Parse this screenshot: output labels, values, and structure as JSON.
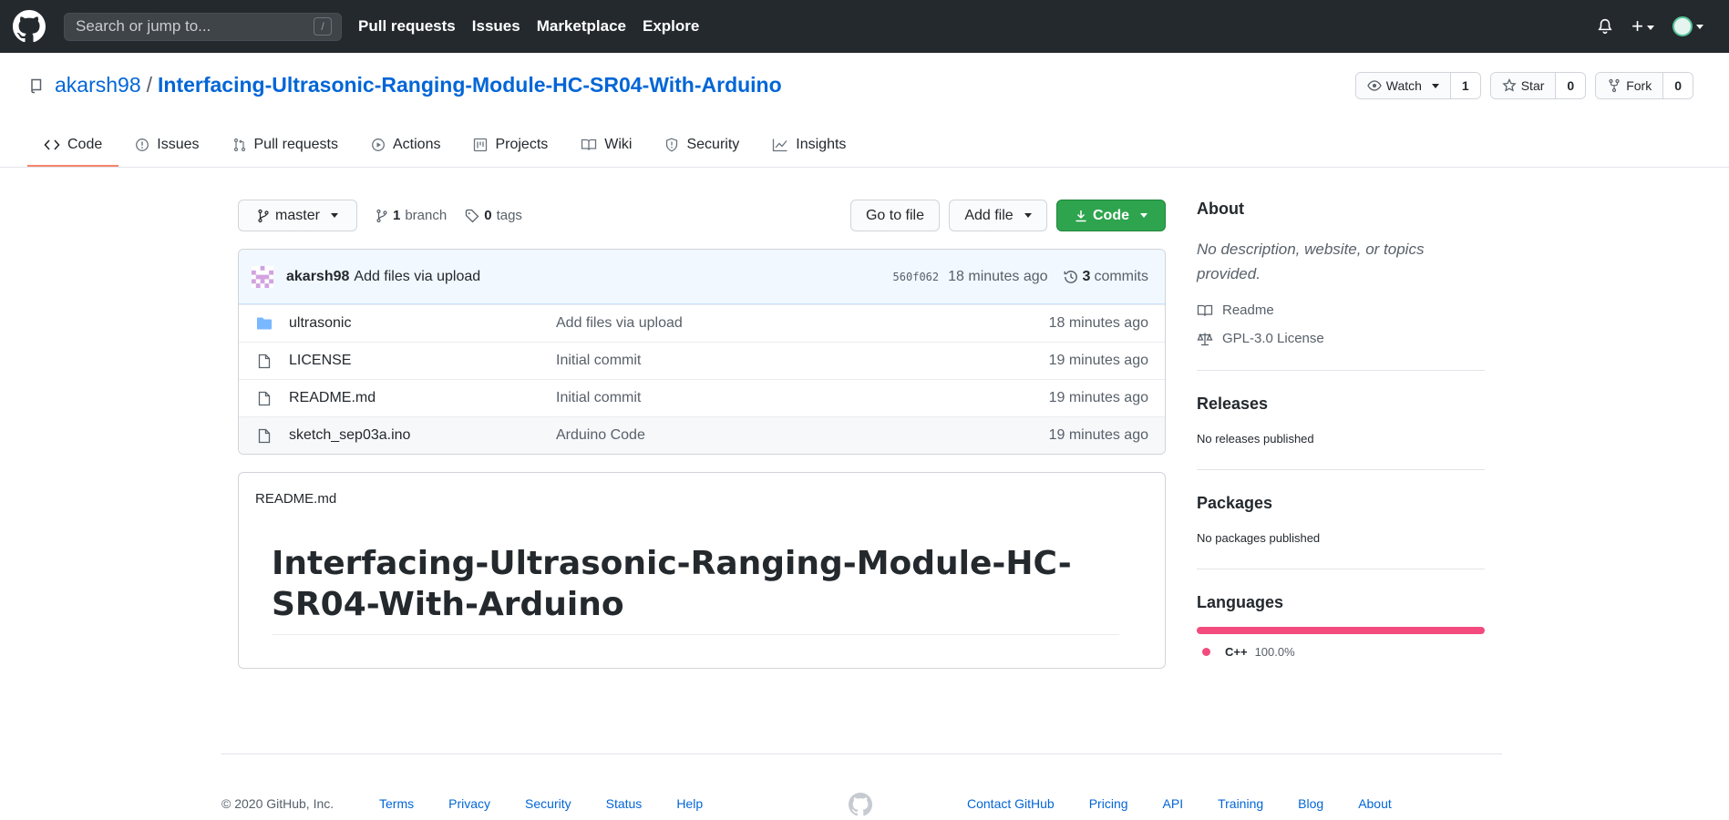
{
  "header": {
    "search_placeholder": "Search or jump to...",
    "search_shortcut": "/",
    "nav": [
      "Pull requests",
      "Issues",
      "Marketplace",
      "Explore"
    ],
    "plus_label": "+"
  },
  "repo": {
    "owner": "akarsh98",
    "separator": "/",
    "name": "Interfacing-Ultrasonic-Ranging-Module-HC-SR04-With-Arduino",
    "watch_label": "Watch",
    "watch_count": "1",
    "star_label": "Star",
    "star_count": "0",
    "fork_label": "Fork",
    "fork_count": "0"
  },
  "tabs": [
    {
      "label": "Code",
      "icon": "code-icon",
      "active": true
    },
    {
      "label": "Issues",
      "icon": "issue-icon"
    },
    {
      "label": "Pull requests",
      "icon": "pull-request-icon"
    },
    {
      "label": "Actions",
      "icon": "play-icon"
    },
    {
      "label": "Projects",
      "icon": "project-icon"
    },
    {
      "label": "Wiki",
      "icon": "book-icon"
    },
    {
      "label": "Security",
      "icon": "shield-icon"
    },
    {
      "label": "Insights",
      "icon": "graph-icon"
    }
  ],
  "file_nav": {
    "branch": "master",
    "branch_count": "1",
    "branch_word": "branch",
    "tag_count": "0",
    "tag_word": "tags",
    "goto_label": "Go to file",
    "add_label": "Add file",
    "code_label": "Code"
  },
  "commit": {
    "author": "akarsh98",
    "message": "Add files via upload",
    "sha": "560f062",
    "time": "18 minutes ago",
    "count": "3",
    "count_word": "commits"
  },
  "files": [
    {
      "type": "folder",
      "name": "ultrasonic",
      "commit": "Add files via upload",
      "age": "18 minutes ago"
    },
    {
      "type": "file",
      "name": "LICENSE",
      "commit": "Initial commit",
      "age": "19 minutes ago"
    },
    {
      "type": "file",
      "name": "README.md",
      "commit": "Initial commit",
      "age": "19 minutes ago"
    },
    {
      "type": "file",
      "name": "sketch_sep03a.ino",
      "commit": "Arduino Code",
      "age": "19 minutes ago"
    }
  ],
  "readme": {
    "label": "README.md",
    "title": "Interfacing-Ultrasonic-Ranging-Module-HC-SR04-With-Arduino"
  },
  "sidebar": {
    "about_title": "About",
    "about_desc": "No description, website, or topics provided.",
    "readme_link": "Readme",
    "license_link": "GPL-3.0 License",
    "releases_title": "Releases",
    "releases_text": "No releases published",
    "packages_title": "Packages",
    "packages_text": "No packages published",
    "languages_title": "Languages",
    "language_name": "C++",
    "language_pct": "100.0%",
    "language_fraction": 1.0,
    "language_color": "#f34b7d"
  },
  "footer": {
    "copyright": "© 2020 GitHub, Inc.",
    "left_links": [
      "Terms",
      "Privacy",
      "Security",
      "Status",
      "Help"
    ],
    "right_links": [
      "Contact GitHub",
      "Pricing",
      "API",
      "Training",
      "Blog",
      "About"
    ]
  }
}
